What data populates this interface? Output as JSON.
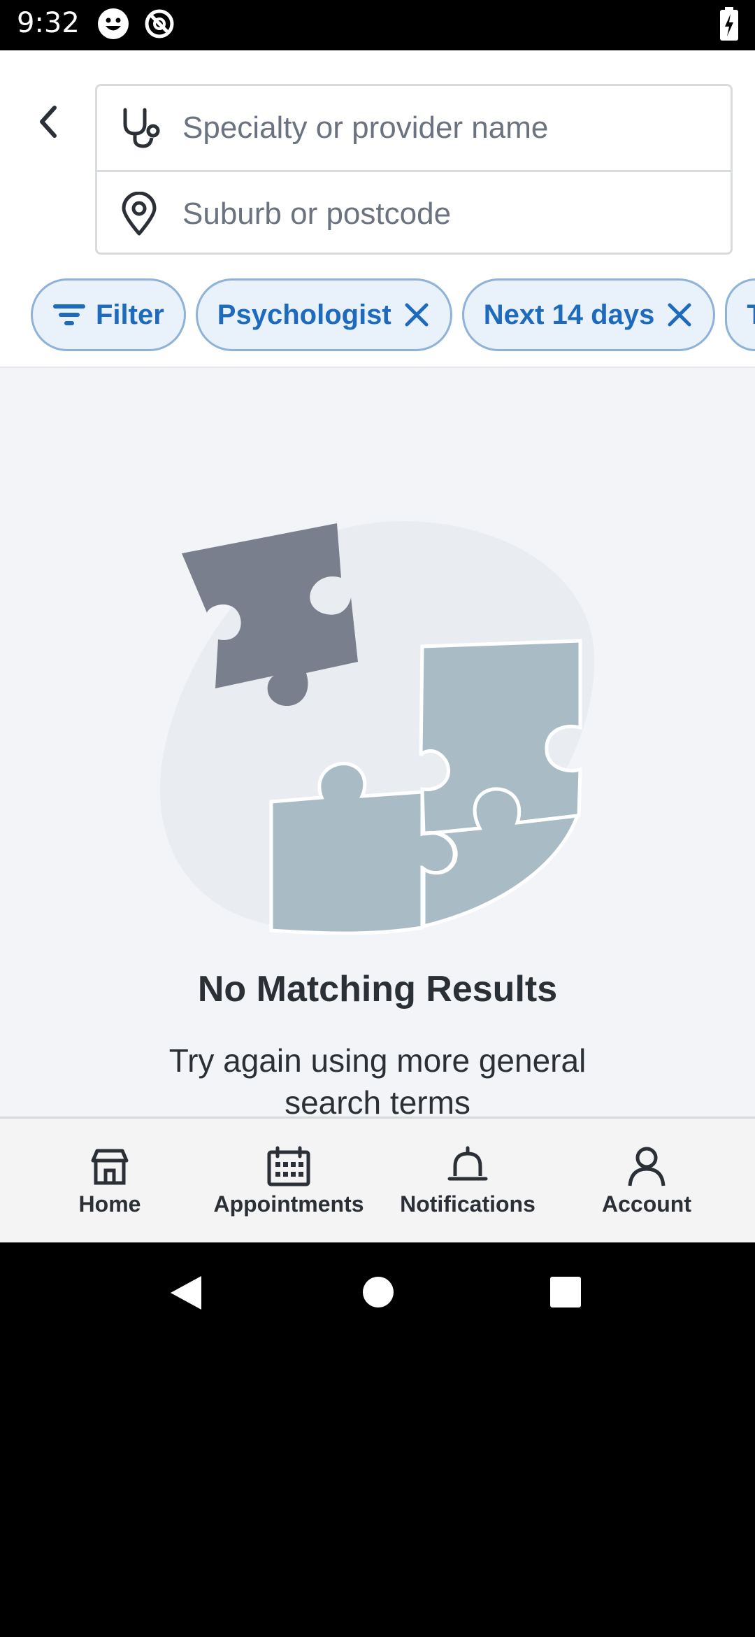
{
  "status_bar": {
    "time": "9:32",
    "icons": [
      "face-icon",
      "data-saver-icon",
      "battery-charging-icon"
    ]
  },
  "search": {
    "specialty_placeholder": "Specialty or provider name",
    "location_placeholder": "Suburb or postcode",
    "specialty_icon": "stethoscope-icon",
    "location_icon": "location-pin-icon"
  },
  "chips": {
    "filter_label": "Filter",
    "items": [
      "Psychologist",
      "Next 14 days",
      "T"
    ]
  },
  "empty_state": {
    "title": "No Matching Results",
    "subtitle": "Try again using more general search terms"
  },
  "bottom_nav": {
    "items": [
      {
        "label": "Home",
        "icon": "home-icon"
      },
      {
        "label": "Appointments",
        "icon": "calendar-icon"
      },
      {
        "label": "Notifications",
        "icon": "bell-icon"
      },
      {
        "label": "Account",
        "icon": "person-icon"
      }
    ]
  },
  "colors": {
    "accent": "#1e6bbd",
    "chip_bg": "#e9f1fa",
    "chip_border": "#8fb2d8",
    "background": "#f2f4f7"
  }
}
